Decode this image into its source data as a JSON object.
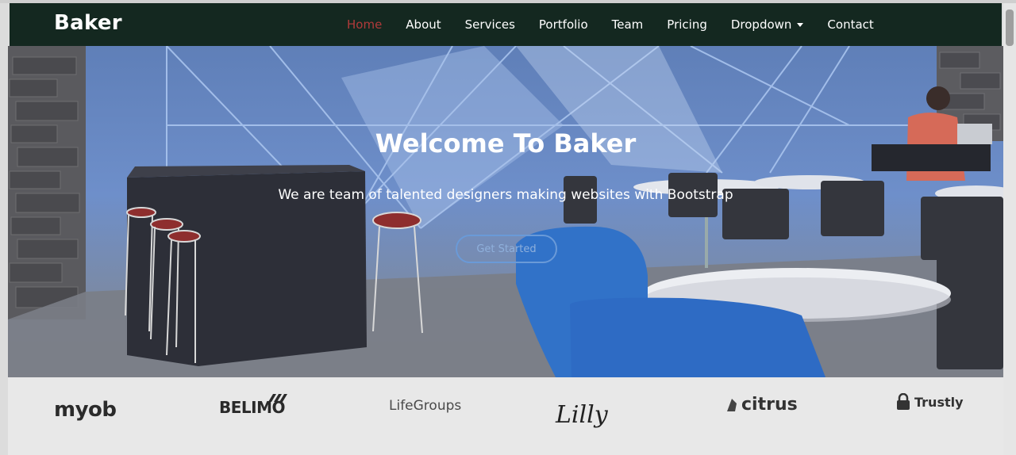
{
  "brand": "Baker",
  "nav": {
    "items": [
      {
        "label": "Home",
        "active": true
      },
      {
        "label": "About"
      },
      {
        "label": "Services"
      },
      {
        "label": "Portfolio"
      },
      {
        "label": "Team"
      },
      {
        "label": "Pricing"
      },
      {
        "label": "Dropdown",
        "has_caret": true
      },
      {
        "label": "Contact"
      }
    ]
  },
  "hero": {
    "title": "Welcome To Baker",
    "subtitle": "We are team of talented designers making websites with Bootstrap",
    "cta": "Get Started"
  },
  "clients": [
    "myob",
    "BELIMO",
    "LifeGroups",
    "Lilly",
    "citrus",
    "Trustly"
  ],
  "colors": {
    "navbar": "#142820",
    "nav_active": "#b03a3a",
    "cta_border": "#6a9ad8"
  }
}
